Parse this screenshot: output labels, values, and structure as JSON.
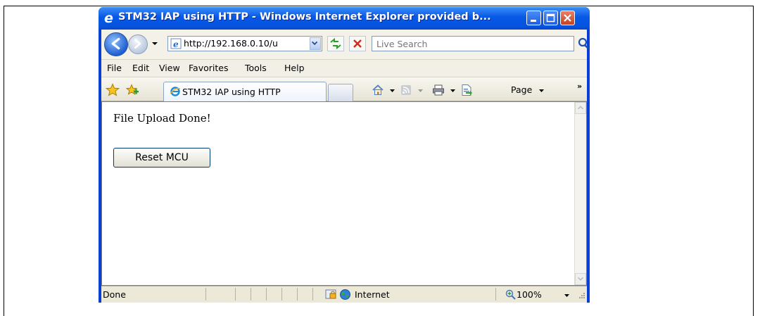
{
  "window": {
    "title": "STM32 IAP using HTTP - Windows Internet Explorer provided b..."
  },
  "address": {
    "url": "http://192.168.0.10/u"
  },
  "search": {
    "placeholder": "Live Search"
  },
  "menu": {
    "items": [
      "File",
      "Edit",
      "View",
      "Favorites",
      "Tools",
      "Help"
    ]
  },
  "tab": {
    "label": "STM32 IAP using HTTP"
  },
  "command_bar": {
    "page_label": "Page",
    "more": "»"
  },
  "content": {
    "message": "File Upload Done!",
    "reset_button": "Reset MCU"
  },
  "status": {
    "text": "Done",
    "zone": "Internet",
    "zoom": "100%"
  },
  "icons": [
    "ie-logo-icon",
    "minimize-icon",
    "maximize-icon",
    "close-icon",
    "back-icon",
    "forward-icon",
    "refresh-icon",
    "stop-icon",
    "search-icon",
    "favorites-star-icon",
    "add-favorites-icon",
    "home-icon",
    "feeds-icon",
    "print-icon",
    "page-icon",
    "lock-icon",
    "globe-icon",
    "zoom-icon"
  ],
  "colors": {
    "titlebar": "#0758e6",
    "window_frame": "#0a3fd6",
    "chrome": "#ece9d8"
  }
}
